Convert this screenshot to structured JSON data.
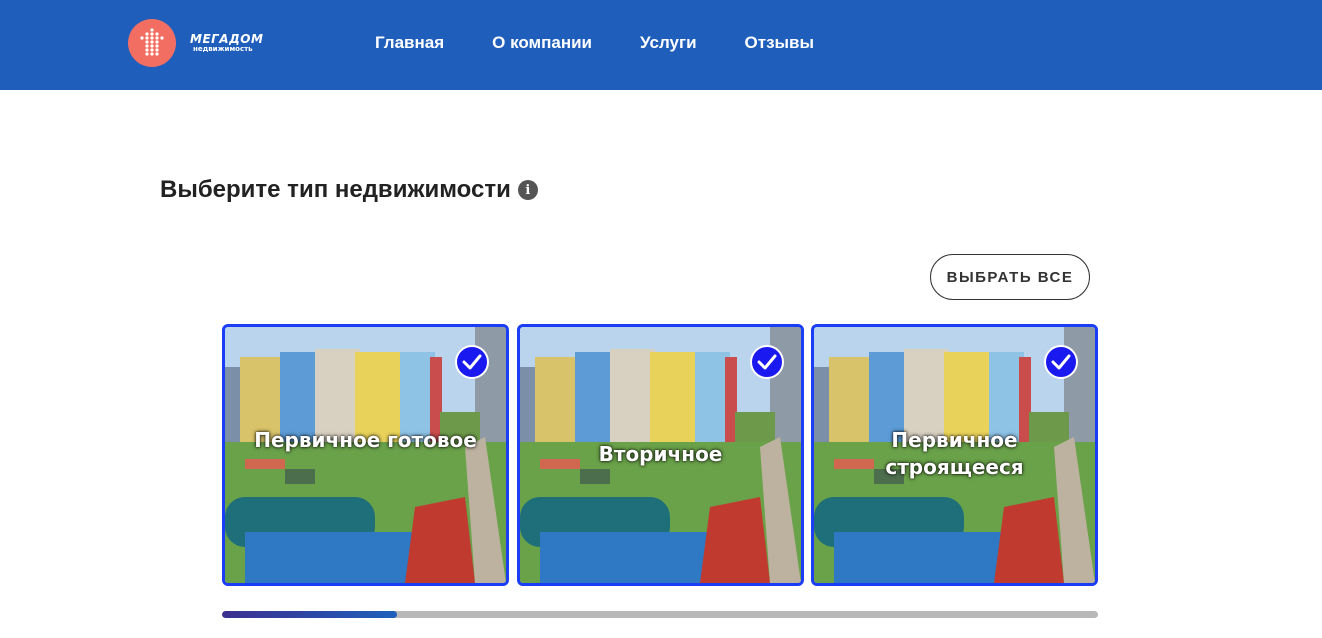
{
  "header": {
    "logo": {
      "title": "МЕГАДОМ",
      "subtitle": "недвижимость",
      "accent_color": "#f26e62"
    },
    "nav": [
      {
        "label": "Главная"
      },
      {
        "label": "О компании"
      },
      {
        "label": "Услуги"
      },
      {
        "label": "Отзывы"
      }
    ],
    "background_color": "#1f5fbb"
  },
  "main": {
    "title": "Выберите тип недвижимости",
    "info_icon": "info-icon",
    "select_all_label": "ВЫБРАТЬ ВСЕ",
    "cards": [
      {
        "label": "Первичное готовое",
        "selected": true,
        "icon": "checkmark-icon"
      },
      {
        "label": "Вторичное",
        "selected": true,
        "icon": "checkmark-icon"
      },
      {
        "label": "Первичное строящееся",
        "selected": true,
        "icon": "checkmark-icon"
      }
    ],
    "selection_border_color": "#1a3df5",
    "progress": 0.2
  }
}
